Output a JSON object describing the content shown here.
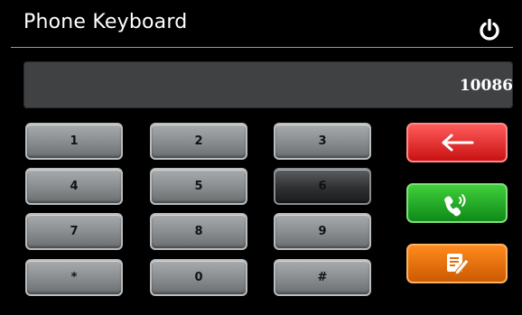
{
  "header": {
    "title": "Phone Keyboard",
    "power_icon": "power-icon"
  },
  "display": {
    "value": "10086"
  },
  "keypad": {
    "keys": [
      "1",
      "2",
      "3",
      "4",
      "5",
      "6",
      "7",
      "8",
      "9",
      "*",
      "0",
      "#"
    ],
    "pressed_key": "6"
  },
  "actions": {
    "backspace_icon": "left-arrow-icon",
    "call_icon": "phone-handset-icon",
    "contacts_icon": "notepad-pen-icon"
  },
  "colors": {
    "backspace": "#d81b1b",
    "call": "#1fa82a",
    "contacts": "#ec6b0e"
  }
}
